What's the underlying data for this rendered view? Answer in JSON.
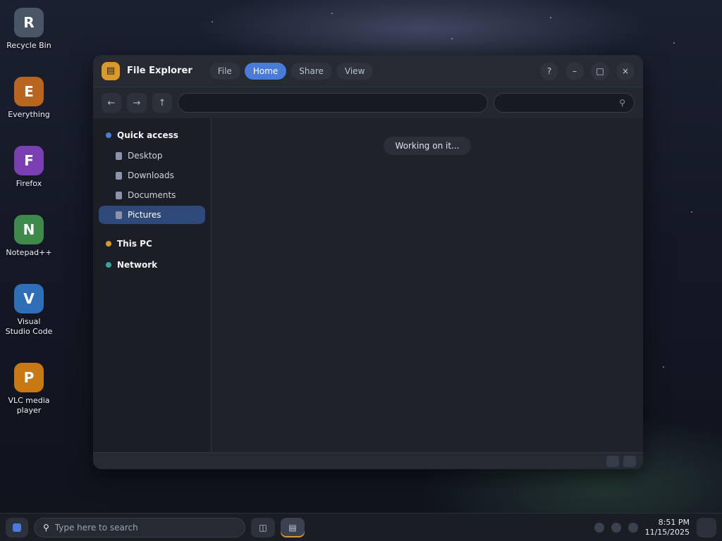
{
  "desktop": {
    "shortcuts": [
      {
        "label": "Recycle Bin",
        "glyph": "R"
      },
      {
        "label": "Everything",
        "glyph": "E"
      },
      {
        "label": "Firefox",
        "glyph": "F"
      },
      {
        "label": "Notepad++",
        "glyph": "N"
      },
      {
        "label": "Visual Studio Code",
        "glyph": "V"
      },
      {
        "label": "VLC media player",
        "glyph": "P"
      }
    ]
  },
  "panel": {
    "title": "File Explorer",
    "badge_glyph": "▤",
    "chips": [
      "File",
      "Home",
      "Share",
      "View"
    ],
    "help_glyph": "?"
  },
  "toolbar": {
    "back_glyph": "←",
    "forward_glyph": "→",
    "up_glyph": "↑",
    "path": "",
    "find_placeholder": ""
  },
  "rail": {
    "group_pinned": "Quick access",
    "pinned": [
      {
        "label": "Desktop"
      },
      {
        "label": "Downloads"
      },
      {
        "label": "Documents"
      },
      {
        "label": "Pictures"
      }
    ],
    "this_pc": "This PC",
    "network": "Network"
  },
  "content": {
    "status": "Working on it..."
  },
  "dock": {
    "search_placeholder": "Type here to search",
    "app_glyph": "▤",
    "time": "8:51 PM",
    "date": "11/15/2025"
  }
}
